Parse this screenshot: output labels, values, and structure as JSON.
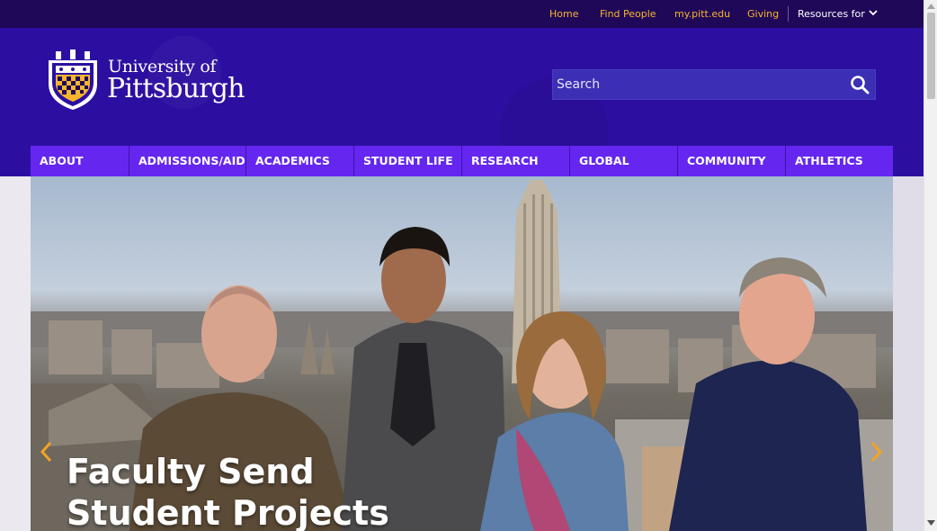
{
  "utility_nav": {
    "links": [
      "Home",
      "Find People",
      "my.pitt.edu",
      "Giving"
    ],
    "resources_label": "Resources for"
  },
  "logo": {
    "line1": "University of",
    "line2": "Pittsburgh",
    "icon": "university-shield-icon"
  },
  "search": {
    "placeholder": "Search",
    "icon": "search-icon"
  },
  "main_nav": {
    "items": [
      "ABOUT",
      "ADMISSIONS/AID",
      "ACADEMICS",
      "STUDENT LIFE",
      "RESEARCH",
      "GLOBAL",
      "COMMUNITY",
      "ATHLETICS"
    ]
  },
  "hero": {
    "caption_line1": "Faculty Send",
    "caption_line2": "Student Projects",
    "prev_icon": "chevron-left-icon",
    "next_icon": "chevron-right-icon"
  },
  "colors": {
    "utility_bar": "#1f0858",
    "header": "#2c0fa0",
    "nav": "#6526f0",
    "accent_gold": "#f7b52e"
  }
}
